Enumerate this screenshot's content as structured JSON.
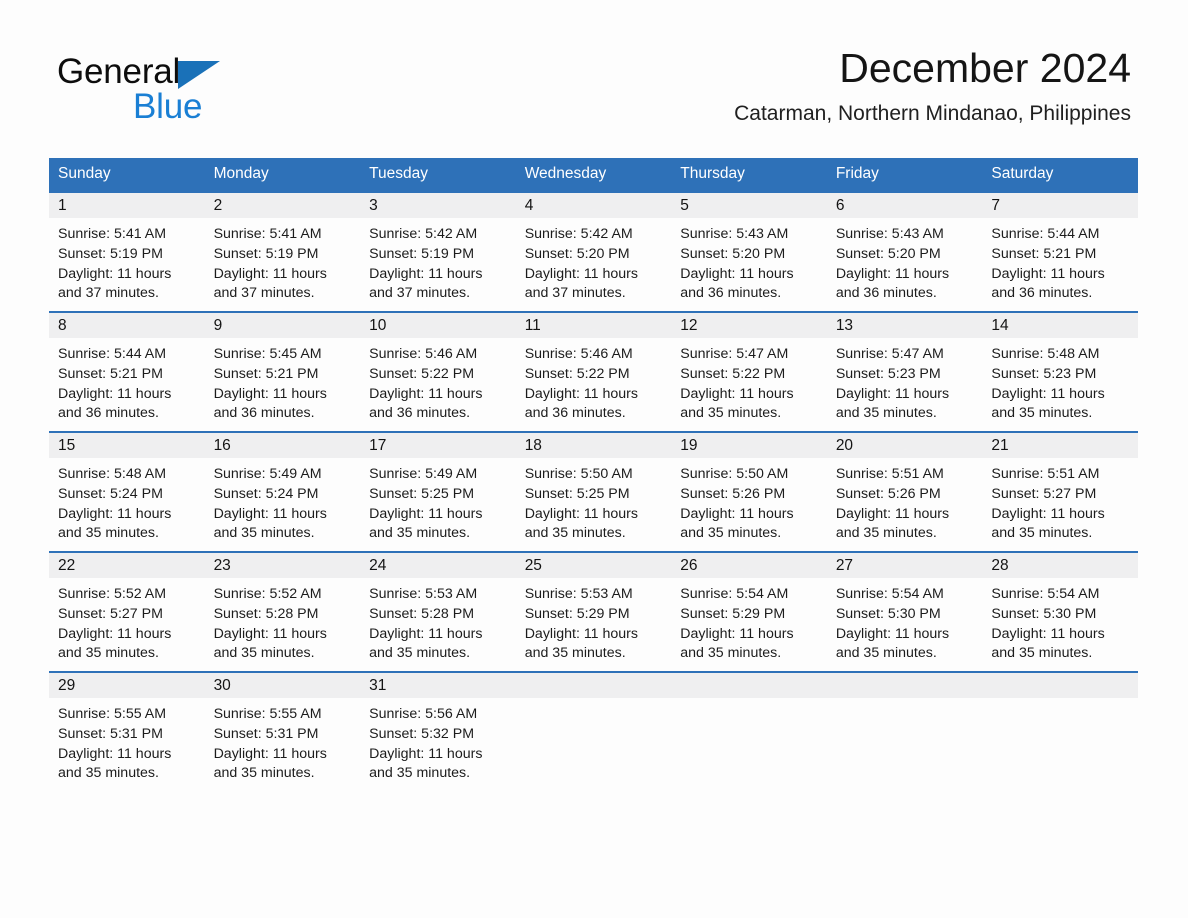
{
  "logo": {
    "word_general": "General",
    "word_blue": "Blue",
    "triangle_color": "#1a71b8",
    "blue_text_color": "#1a7fd4"
  },
  "header": {
    "title": "December 2024",
    "subtitle": "Catarman, Northern Mindanao, Philippines"
  },
  "theme": {
    "header_bg": "#2e71b8",
    "header_text": "#ffffff",
    "daynum_band_bg": "#efeff0",
    "page_bg": "#fdfdfd",
    "row_divider": "#2e71b8"
  },
  "calendar": {
    "columns": [
      "Sunday",
      "Monday",
      "Tuesday",
      "Wednesday",
      "Thursday",
      "Friday",
      "Saturday"
    ],
    "weeks": [
      [
        {
          "day": "1",
          "sunrise": "Sunrise: 5:41 AM",
          "sunset": "Sunset: 5:19 PM",
          "daylight_line1": "Daylight: 11 hours",
          "daylight_line2": "and 37 minutes."
        },
        {
          "day": "2",
          "sunrise": "Sunrise: 5:41 AM",
          "sunset": "Sunset: 5:19 PM",
          "daylight_line1": "Daylight: 11 hours",
          "daylight_line2": "and 37 minutes."
        },
        {
          "day": "3",
          "sunrise": "Sunrise: 5:42 AM",
          "sunset": "Sunset: 5:19 PM",
          "daylight_line1": "Daylight: 11 hours",
          "daylight_line2": "and 37 minutes."
        },
        {
          "day": "4",
          "sunrise": "Sunrise: 5:42 AM",
          "sunset": "Sunset: 5:20 PM",
          "daylight_line1": "Daylight: 11 hours",
          "daylight_line2": "and 37 minutes."
        },
        {
          "day": "5",
          "sunrise": "Sunrise: 5:43 AM",
          "sunset": "Sunset: 5:20 PM",
          "daylight_line1": "Daylight: 11 hours",
          "daylight_line2": "and 36 minutes."
        },
        {
          "day": "6",
          "sunrise": "Sunrise: 5:43 AM",
          "sunset": "Sunset: 5:20 PM",
          "daylight_line1": "Daylight: 11 hours",
          "daylight_line2": "and 36 minutes."
        },
        {
          "day": "7",
          "sunrise": "Sunrise: 5:44 AM",
          "sunset": "Sunset: 5:21 PM",
          "daylight_line1": "Daylight: 11 hours",
          "daylight_line2": "and 36 minutes."
        }
      ],
      [
        {
          "day": "8",
          "sunrise": "Sunrise: 5:44 AM",
          "sunset": "Sunset: 5:21 PM",
          "daylight_line1": "Daylight: 11 hours",
          "daylight_line2": "and 36 minutes."
        },
        {
          "day": "9",
          "sunrise": "Sunrise: 5:45 AM",
          "sunset": "Sunset: 5:21 PM",
          "daylight_line1": "Daylight: 11 hours",
          "daylight_line2": "and 36 minutes."
        },
        {
          "day": "10",
          "sunrise": "Sunrise: 5:46 AM",
          "sunset": "Sunset: 5:22 PM",
          "daylight_line1": "Daylight: 11 hours",
          "daylight_line2": "and 36 minutes."
        },
        {
          "day": "11",
          "sunrise": "Sunrise: 5:46 AM",
          "sunset": "Sunset: 5:22 PM",
          "daylight_line1": "Daylight: 11 hours",
          "daylight_line2": "and 36 minutes."
        },
        {
          "day": "12",
          "sunrise": "Sunrise: 5:47 AM",
          "sunset": "Sunset: 5:22 PM",
          "daylight_line1": "Daylight: 11 hours",
          "daylight_line2": "and 35 minutes."
        },
        {
          "day": "13",
          "sunrise": "Sunrise: 5:47 AM",
          "sunset": "Sunset: 5:23 PM",
          "daylight_line1": "Daylight: 11 hours",
          "daylight_line2": "and 35 minutes."
        },
        {
          "day": "14",
          "sunrise": "Sunrise: 5:48 AM",
          "sunset": "Sunset: 5:23 PM",
          "daylight_line1": "Daylight: 11 hours",
          "daylight_line2": "and 35 minutes."
        }
      ],
      [
        {
          "day": "15",
          "sunrise": "Sunrise: 5:48 AM",
          "sunset": "Sunset: 5:24 PM",
          "daylight_line1": "Daylight: 11 hours",
          "daylight_line2": "and 35 minutes."
        },
        {
          "day": "16",
          "sunrise": "Sunrise: 5:49 AM",
          "sunset": "Sunset: 5:24 PM",
          "daylight_line1": "Daylight: 11 hours",
          "daylight_line2": "and 35 minutes."
        },
        {
          "day": "17",
          "sunrise": "Sunrise: 5:49 AM",
          "sunset": "Sunset: 5:25 PM",
          "daylight_line1": "Daylight: 11 hours",
          "daylight_line2": "and 35 minutes."
        },
        {
          "day": "18",
          "sunrise": "Sunrise: 5:50 AM",
          "sunset": "Sunset: 5:25 PM",
          "daylight_line1": "Daylight: 11 hours",
          "daylight_line2": "and 35 minutes."
        },
        {
          "day": "19",
          "sunrise": "Sunrise: 5:50 AM",
          "sunset": "Sunset: 5:26 PM",
          "daylight_line1": "Daylight: 11 hours",
          "daylight_line2": "and 35 minutes."
        },
        {
          "day": "20",
          "sunrise": "Sunrise: 5:51 AM",
          "sunset": "Sunset: 5:26 PM",
          "daylight_line1": "Daylight: 11 hours",
          "daylight_line2": "and 35 minutes."
        },
        {
          "day": "21",
          "sunrise": "Sunrise: 5:51 AM",
          "sunset": "Sunset: 5:27 PM",
          "daylight_line1": "Daylight: 11 hours",
          "daylight_line2": "and 35 minutes."
        }
      ],
      [
        {
          "day": "22",
          "sunrise": "Sunrise: 5:52 AM",
          "sunset": "Sunset: 5:27 PM",
          "daylight_line1": "Daylight: 11 hours",
          "daylight_line2": "and 35 minutes."
        },
        {
          "day": "23",
          "sunrise": "Sunrise: 5:52 AM",
          "sunset": "Sunset: 5:28 PM",
          "daylight_line1": "Daylight: 11 hours",
          "daylight_line2": "and 35 minutes."
        },
        {
          "day": "24",
          "sunrise": "Sunrise: 5:53 AM",
          "sunset": "Sunset: 5:28 PM",
          "daylight_line1": "Daylight: 11 hours",
          "daylight_line2": "and 35 minutes."
        },
        {
          "day": "25",
          "sunrise": "Sunrise: 5:53 AM",
          "sunset": "Sunset: 5:29 PM",
          "daylight_line1": "Daylight: 11 hours",
          "daylight_line2": "and 35 minutes."
        },
        {
          "day": "26",
          "sunrise": "Sunrise: 5:54 AM",
          "sunset": "Sunset: 5:29 PM",
          "daylight_line1": "Daylight: 11 hours",
          "daylight_line2": "and 35 minutes."
        },
        {
          "day": "27",
          "sunrise": "Sunrise: 5:54 AM",
          "sunset": "Sunset: 5:30 PM",
          "daylight_line1": "Daylight: 11 hours",
          "daylight_line2": "and 35 minutes."
        },
        {
          "day": "28",
          "sunrise": "Sunrise: 5:54 AM",
          "sunset": "Sunset: 5:30 PM",
          "daylight_line1": "Daylight: 11 hours",
          "daylight_line2": "and 35 minutes."
        }
      ],
      [
        {
          "day": "29",
          "sunrise": "Sunrise: 5:55 AM",
          "sunset": "Sunset: 5:31 PM",
          "daylight_line1": "Daylight: 11 hours",
          "daylight_line2": "and 35 minutes."
        },
        {
          "day": "30",
          "sunrise": "Sunrise: 5:55 AM",
          "sunset": "Sunset: 5:31 PM",
          "daylight_line1": "Daylight: 11 hours",
          "daylight_line2": "and 35 minutes."
        },
        {
          "day": "31",
          "sunrise": "Sunrise: 5:56 AM",
          "sunset": "Sunset: 5:32 PM",
          "daylight_line1": "Daylight: 11 hours",
          "daylight_line2": "and 35 minutes."
        },
        {
          "day": "",
          "sunrise": "",
          "sunset": "",
          "daylight_line1": "",
          "daylight_line2": ""
        },
        {
          "day": "",
          "sunrise": "",
          "sunset": "",
          "daylight_line1": "",
          "daylight_line2": ""
        },
        {
          "day": "",
          "sunrise": "",
          "sunset": "",
          "daylight_line1": "",
          "daylight_line2": ""
        },
        {
          "day": "",
          "sunrise": "",
          "sunset": "",
          "daylight_line1": "",
          "daylight_line2": ""
        }
      ]
    ]
  }
}
